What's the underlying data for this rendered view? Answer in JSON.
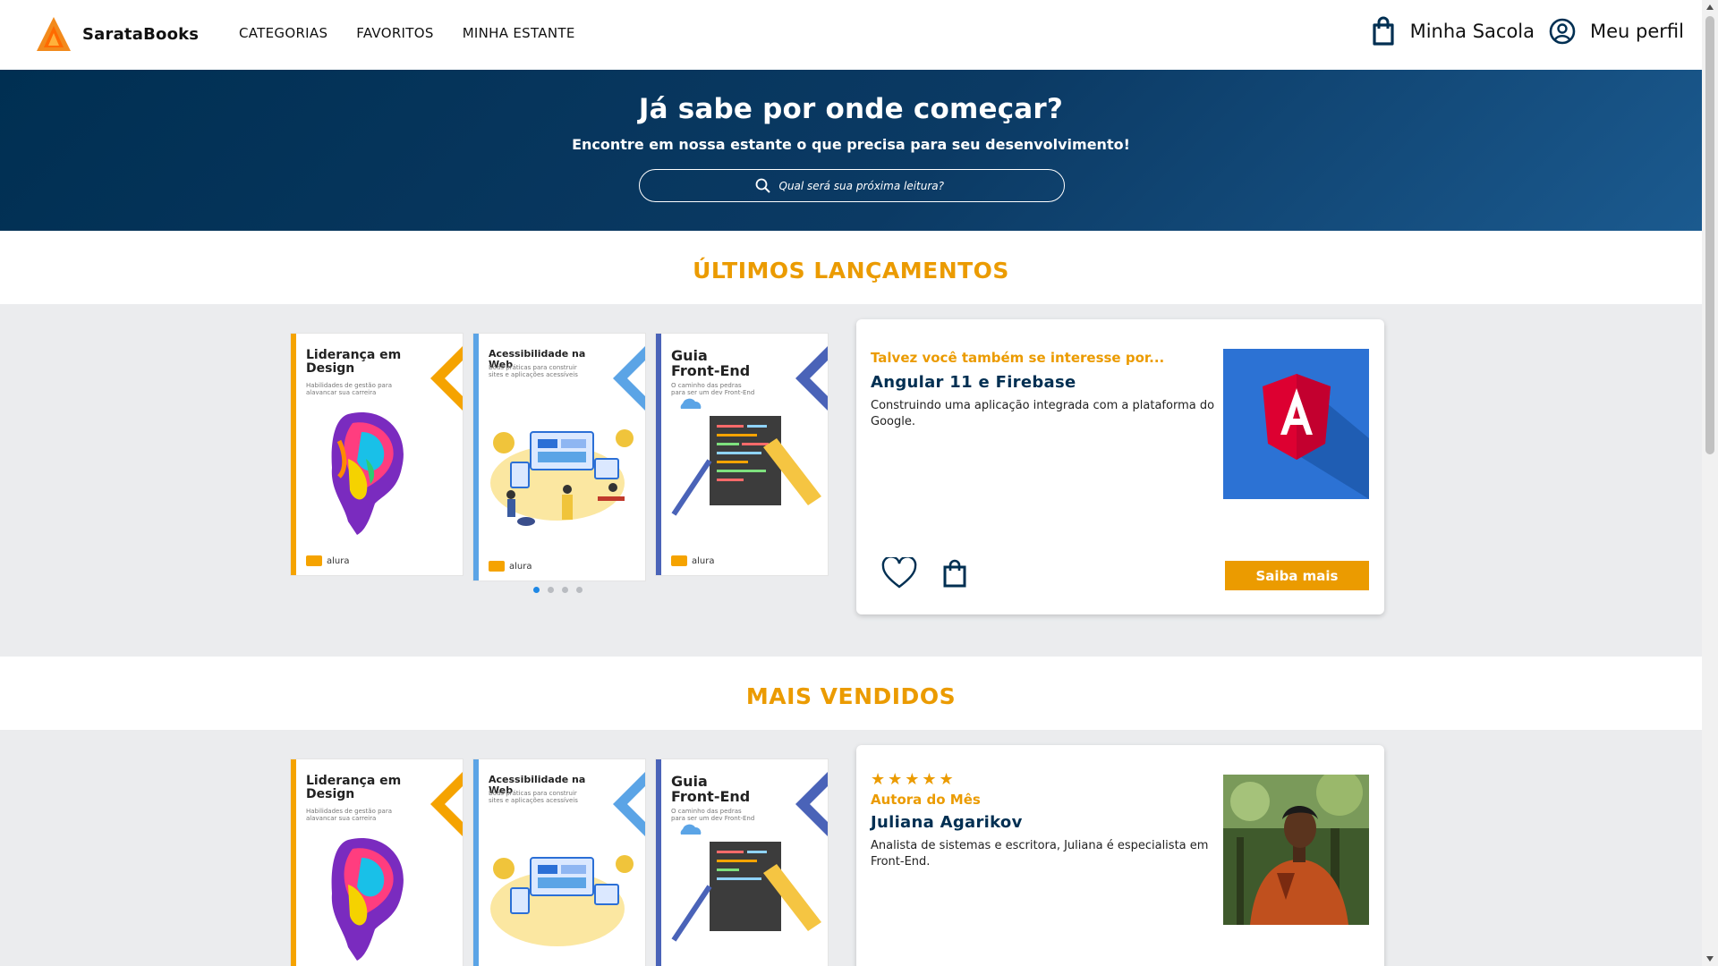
{
  "brand": {
    "name": "SarataBooks",
    "logo_icon": "triangle-logo-icon",
    "accent": "#eb9b00",
    "navy": "#002f52"
  },
  "nav": {
    "items": [
      "CATEGORIAS",
      "FAVORITOS",
      "MINHA ESTANTE"
    ]
  },
  "header": {
    "bag_label": "Minha Sacola",
    "profile_label": "Meu perfil"
  },
  "hero": {
    "title": "Já sabe por onde começar?",
    "subtitle": "Encontre em nossa estante o que precisa para seu desenvolvimento!",
    "search_placeholder": "Qual será sua próxima leitura?"
  },
  "sections": [
    {
      "title": "ÚLTIMOS LANÇAMENTOS",
      "books": [
        {
          "title": "Liderança em Design",
          "subtitle": "Habilidades de gestão para alavancar sua carreira",
          "color": "#f5a300"
        },
        {
          "title": "Acessibilidade na Web",
          "subtitle": "Boas práticas para construir sites e aplicações acessíveis",
          "color": "#5ba4e6"
        },
        {
          "title": "Guia Front-End",
          "subtitle": "O caminho das pedras para ser um dev Front-End",
          "color": "#4a63b8"
        }
      ],
      "carousel_dots": 4,
      "active_dot": 0,
      "card": {
        "kicker": "Talvez você também se interesse por...",
        "title": "Angular 11 e Firebase",
        "description": "Construindo uma aplicação integrada com a plataforma do Google.",
        "button": "Saiba mais"
      }
    },
    {
      "title": "MAIS VENDIDOS",
      "books": [
        {
          "title": "Liderança em Design",
          "subtitle": "Habilidades de gestão para alavancar sua carreira",
          "color": "#f5a300"
        },
        {
          "title": "Acessibilidade na Web",
          "subtitle": "Boas práticas para construir sites e aplicações acessíveis",
          "color": "#5ba4e6"
        },
        {
          "title": "Guia Front-End",
          "subtitle": "O caminho das pedras para ser um dev Front-End",
          "color": "#4a63b8"
        }
      ],
      "card": {
        "rating_stars": 5,
        "kicker": "Autora do Mês",
        "title": "Juliana Agarikov",
        "description": "Analista de sistemas e escritora, Juliana é especialista em Front-End."
      }
    }
  ],
  "publisher": "alura"
}
